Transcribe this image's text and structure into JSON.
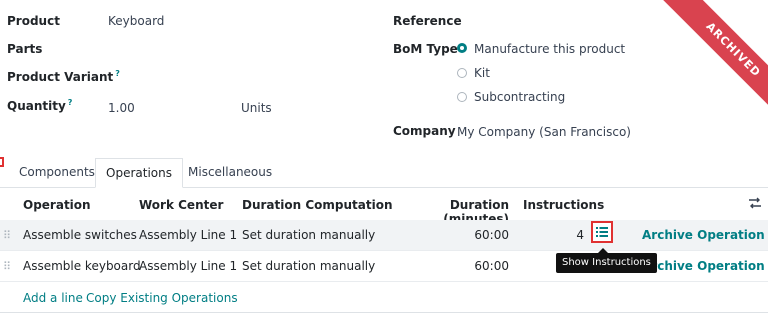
{
  "form": {
    "product_label": "Product",
    "product_value": "Keyboard",
    "parts_label": "Parts",
    "variant_label": "Product Variant",
    "variant_help": "?",
    "quantity_label": "Quantity",
    "quantity_help": "?",
    "quantity_value": "1.00",
    "quantity_unit": "Units",
    "reference_label": "Reference",
    "bom_type_label": "BoM Type",
    "bom_type_options": [
      {
        "label": "Manufacture this product",
        "checked": true
      },
      {
        "label": "Kit",
        "checked": false
      },
      {
        "label": "Subcontracting",
        "checked": false
      }
    ],
    "company_label": "Company",
    "company_value": "My Company (San Francisco)"
  },
  "ribbon": {
    "text": "ARCHIVED",
    "color": "#d9434f"
  },
  "tabs": [
    {
      "label": "Components",
      "active": false
    },
    {
      "label": "Operations",
      "active": true
    },
    {
      "label": "Miscellaneous",
      "active": false
    }
  ],
  "table": {
    "headers": [
      "Operation",
      "Work Center",
      "Duration Computation",
      "Duration (minutes)",
      "Instructions"
    ],
    "rows": [
      {
        "operation": "Assemble switches",
        "work_center": "Assembly Line 1",
        "computation": "Set duration manually",
        "duration": "60:00",
        "instructions": "4",
        "action": "Archive Operation"
      },
      {
        "operation": "Assemble keyboard",
        "work_center": "Assembly Line 1",
        "computation": "Set duration manually",
        "duration": "60:00",
        "instructions": "",
        "action": "Archive Operation"
      }
    ],
    "add_line": "Add a line",
    "copy_operations": "Copy Existing Operations"
  },
  "tooltip": {
    "text": "Show Instructions"
  },
  "colors": {
    "accent": "#017e84",
    "highlight": "#e03131"
  }
}
